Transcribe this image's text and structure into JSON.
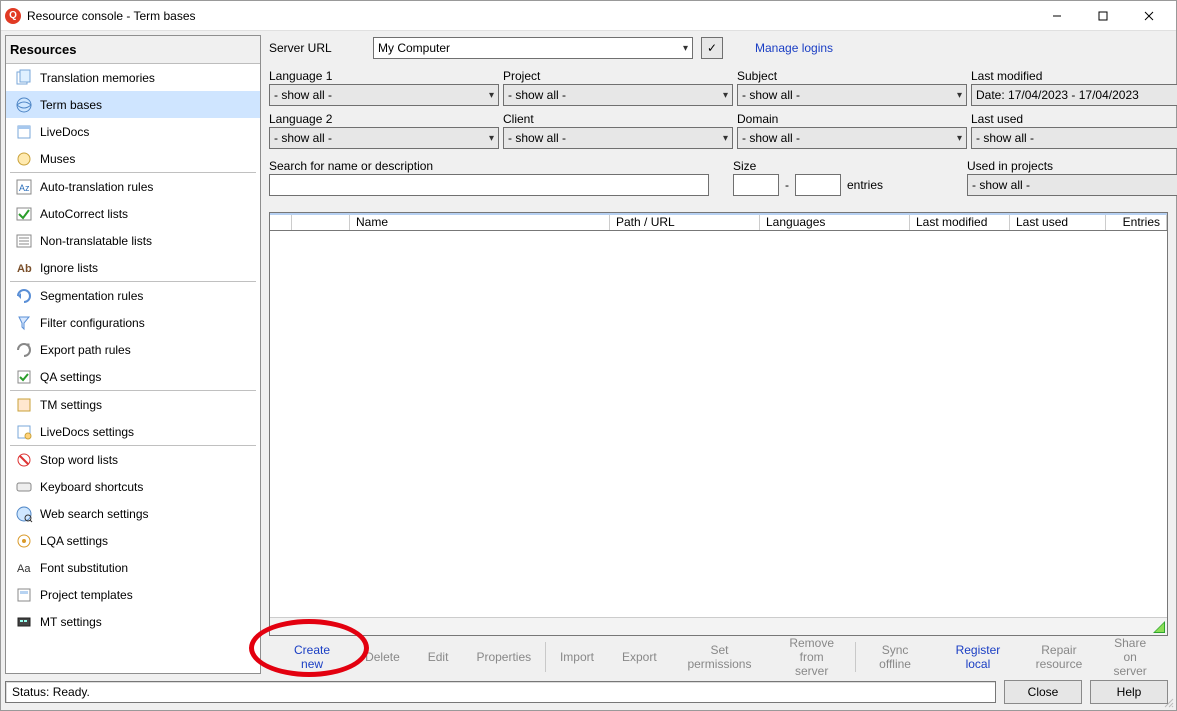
{
  "window": {
    "title": "Resource console - Term bases"
  },
  "sidebar": {
    "title": "Resources",
    "items": [
      {
        "label": "Translation memories"
      },
      {
        "label": "Term bases",
        "selected": true
      },
      {
        "label": "LiveDocs"
      },
      {
        "label": "Muses"
      },
      {
        "sep": true
      },
      {
        "label": "Auto-translation rules"
      },
      {
        "label": "AutoCorrect lists"
      },
      {
        "label": "Non-translatable lists"
      },
      {
        "label": "Ignore lists"
      },
      {
        "sep": true
      },
      {
        "label": "Segmentation rules"
      },
      {
        "label": "Filter configurations"
      },
      {
        "label": "Export path rules"
      },
      {
        "label": "QA settings"
      },
      {
        "sep": true
      },
      {
        "label": "TM settings"
      },
      {
        "label": "LiveDocs settings"
      },
      {
        "sep": true
      },
      {
        "label": "Stop word lists"
      },
      {
        "label": "Keyboard shortcuts"
      },
      {
        "label": "Web search settings"
      },
      {
        "label": "LQA settings"
      },
      {
        "label": "Font substitution"
      },
      {
        "label": "Project templates"
      },
      {
        "label": "MT settings"
      }
    ]
  },
  "filters": {
    "serverurl_label": "Server URL",
    "serverurl_value": "My Computer",
    "manage_logins": "Manage logins",
    "row1": [
      {
        "label": "Language 1",
        "value": "- show all -"
      },
      {
        "label": "Project",
        "value": "- show all -"
      },
      {
        "label": "Subject",
        "value": "- show all -"
      },
      {
        "label": "Last modified",
        "value": "Date: 17/04/2023 - 17/04/2023"
      }
    ],
    "row2": [
      {
        "label": "Language 2",
        "value": "- show all -"
      },
      {
        "label": "Client",
        "value": "- show all -"
      },
      {
        "label": "Domain",
        "value": "- show all -"
      },
      {
        "label": "Last used",
        "value": "- show all -"
      }
    ],
    "search_label": "Search for name or description",
    "size_label": "Size",
    "size_sep": "-",
    "size_unit": "entries",
    "usedin_label": "Used in projects",
    "usedin_value": "- show all -"
  },
  "table": {
    "columns": [
      "",
      "",
      "Name",
      "Path / URL",
      "Languages",
      "Last modified",
      "Last used",
      "Entries"
    ]
  },
  "actions": {
    "create_new": "Create new",
    "delete": "Delete",
    "edit": "Edit",
    "properties": "Properties",
    "import": "Import",
    "export": "Export",
    "set_permissions": "Set permissions",
    "remove_from_server": "Remove from\nserver",
    "sync_offline": "Sync offline",
    "register_local": "Register local",
    "repair": "Repair\nresource",
    "share": "Share on\nserver"
  },
  "bottom": {
    "status": "Status: Ready.",
    "close": "Close",
    "help": "Help"
  }
}
